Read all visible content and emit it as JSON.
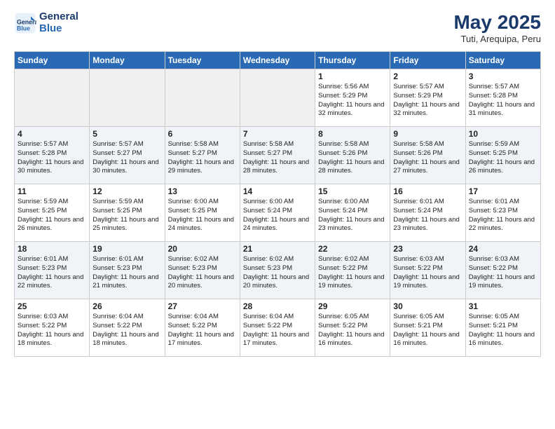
{
  "header": {
    "logo_line1": "General",
    "logo_line2": "Blue",
    "month_year": "May 2025",
    "location": "Tuti, Arequipa, Peru"
  },
  "days_of_week": [
    "Sunday",
    "Monday",
    "Tuesday",
    "Wednesday",
    "Thursday",
    "Friday",
    "Saturday"
  ],
  "weeks": [
    [
      {
        "day": "",
        "info": ""
      },
      {
        "day": "",
        "info": ""
      },
      {
        "day": "",
        "info": ""
      },
      {
        "day": "",
        "info": ""
      },
      {
        "day": "1",
        "info": "Sunrise: 5:56 AM\nSunset: 5:29 PM\nDaylight: 11 hours and 32 minutes."
      },
      {
        "day": "2",
        "info": "Sunrise: 5:57 AM\nSunset: 5:29 PM\nDaylight: 11 hours and 32 minutes."
      },
      {
        "day": "3",
        "info": "Sunrise: 5:57 AM\nSunset: 5:28 PM\nDaylight: 11 hours and 31 minutes."
      }
    ],
    [
      {
        "day": "4",
        "info": "Sunrise: 5:57 AM\nSunset: 5:28 PM\nDaylight: 11 hours and 30 minutes."
      },
      {
        "day": "5",
        "info": "Sunrise: 5:57 AM\nSunset: 5:27 PM\nDaylight: 11 hours and 30 minutes."
      },
      {
        "day": "6",
        "info": "Sunrise: 5:58 AM\nSunset: 5:27 PM\nDaylight: 11 hours and 29 minutes."
      },
      {
        "day": "7",
        "info": "Sunrise: 5:58 AM\nSunset: 5:27 PM\nDaylight: 11 hours and 28 minutes."
      },
      {
        "day": "8",
        "info": "Sunrise: 5:58 AM\nSunset: 5:26 PM\nDaylight: 11 hours and 28 minutes."
      },
      {
        "day": "9",
        "info": "Sunrise: 5:58 AM\nSunset: 5:26 PM\nDaylight: 11 hours and 27 minutes."
      },
      {
        "day": "10",
        "info": "Sunrise: 5:59 AM\nSunset: 5:25 PM\nDaylight: 11 hours and 26 minutes."
      }
    ],
    [
      {
        "day": "11",
        "info": "Sunrise: 5:59 AM\nSunset: 5:25 PM\nDaylight: 11 hours and 26 minutes."
      },
      {
        "day": "12",
        "info": "Sunrise: 5:59 AM\nSunset: 5:25 PM\nDaylight: 11 hours and 25 minutes."
      },
      {
        "day": "13",
        "info": "Sunrise: 6:00 AM\nSunset: 5:25 PM\nDaylight: 11 hours and 24 minutes."
      },
      {
        "day": "14",
        "info": "Sunrise: 6:00 AM\nSunset: 5:24 PM\nDaylight: 11 hours and 24 minutes."
      },
      {
        "day": "15",
        "info": "Sunrise: 6:00 AM\nSunset: 5:24 PM\nDaylight: 11 hours and 23 minutes."
      },
      {
        "day": "16",
        "info": "Sunrise: 6:01 AM\nSunset: 5:24 PM\nDaylight: 11 hours and 23 minutes."
      },
      {
        "day": "17",
        "info": "Sunrise: 6:01 AM\nSunset: 5:23 PM\nDaylight: 11 hours and 22 minutes."
      }
    ],
    [
      {
        "day": "18",
        "info": "Sunrise: 6:01 AM\nSunset: 5:23 PM\nDaylight: 11 hours and 22 minutes."
      },
      {
        "day": "19",
        "info": "Sunrise: 6:01 AM\nSunset: 5:23 PM\nDaylight: 11 hours and 21 minutes."
      },
      {
        "day": "20",
        "info": "Sunrise: 6:02 AM\nSunset: 5:23 PM\nDaylight: 11 hours and 20 minutes."
      },
      {
        "day": "21",
        "info": "Sunrise: 6:02 AM\nSunset: 5:23 PM\nDaylight: 11 hours and 20 minutes."
      },
      {
        "day": "22",
        "info": "Sunrise: 6:02 AM\nSunset: 5:22 PM\nDaylight: 11 hours and 19 minutes."
      },
      {
        "day": "23",
        "info": "Sunrise: 6:03 AM\nSunset: 5:22 PM\nDaylight: 11 hours and 19 minutes."
      },
      {
        "day": "24",
        "info": "Sunrise: 6:03 AM\nSunset: 5:22 PM\nDaylight: 11 hours and 19 minutes."
      }
    ],
    [
      {
        "day": "25",
        "info": "Sunrise: 6:03 AM\nSunset: 5:22 PM\nDaylight: 11 hours and 18 minutes."
      },
      {
        "day": "26",
        "info": "Sunrise: 6:04 AM\nSunset: 5:22 PM\nDaylight: 11 hours and 18 minutes."
      },
      {
        "day": "27",
        "info": "Sunrise: 6:04 AM\nSunset: 5:22 PM\nDaylight: 11 hours and 17 minutes."
      },
      {
        "day": "28",
        "info": "Sunrise: 6:04 AM\nSunset: 5:22 PM\nDaylight: 11 hours and 17 minutes."
      },
      {
        "day": "29",
        "info": "Sunrise: 6:05 AM\nSunset: 5:22 PM\nDaylight: 11 hours and 16 minutes."
      },
      {
        "day": "30",
        "info": "Sunrise: 6:05 AM\nSunset: 5:21 PM\nDaylight: 11 hours and 16 minutes."
      },
      {
        "day": "31",
        "info": "Sunrise: 6:05 AM\nSunset: 5:21 PM\nDaylight: 11 hours and 16 minutes."
      }
    ]
  ]
}
